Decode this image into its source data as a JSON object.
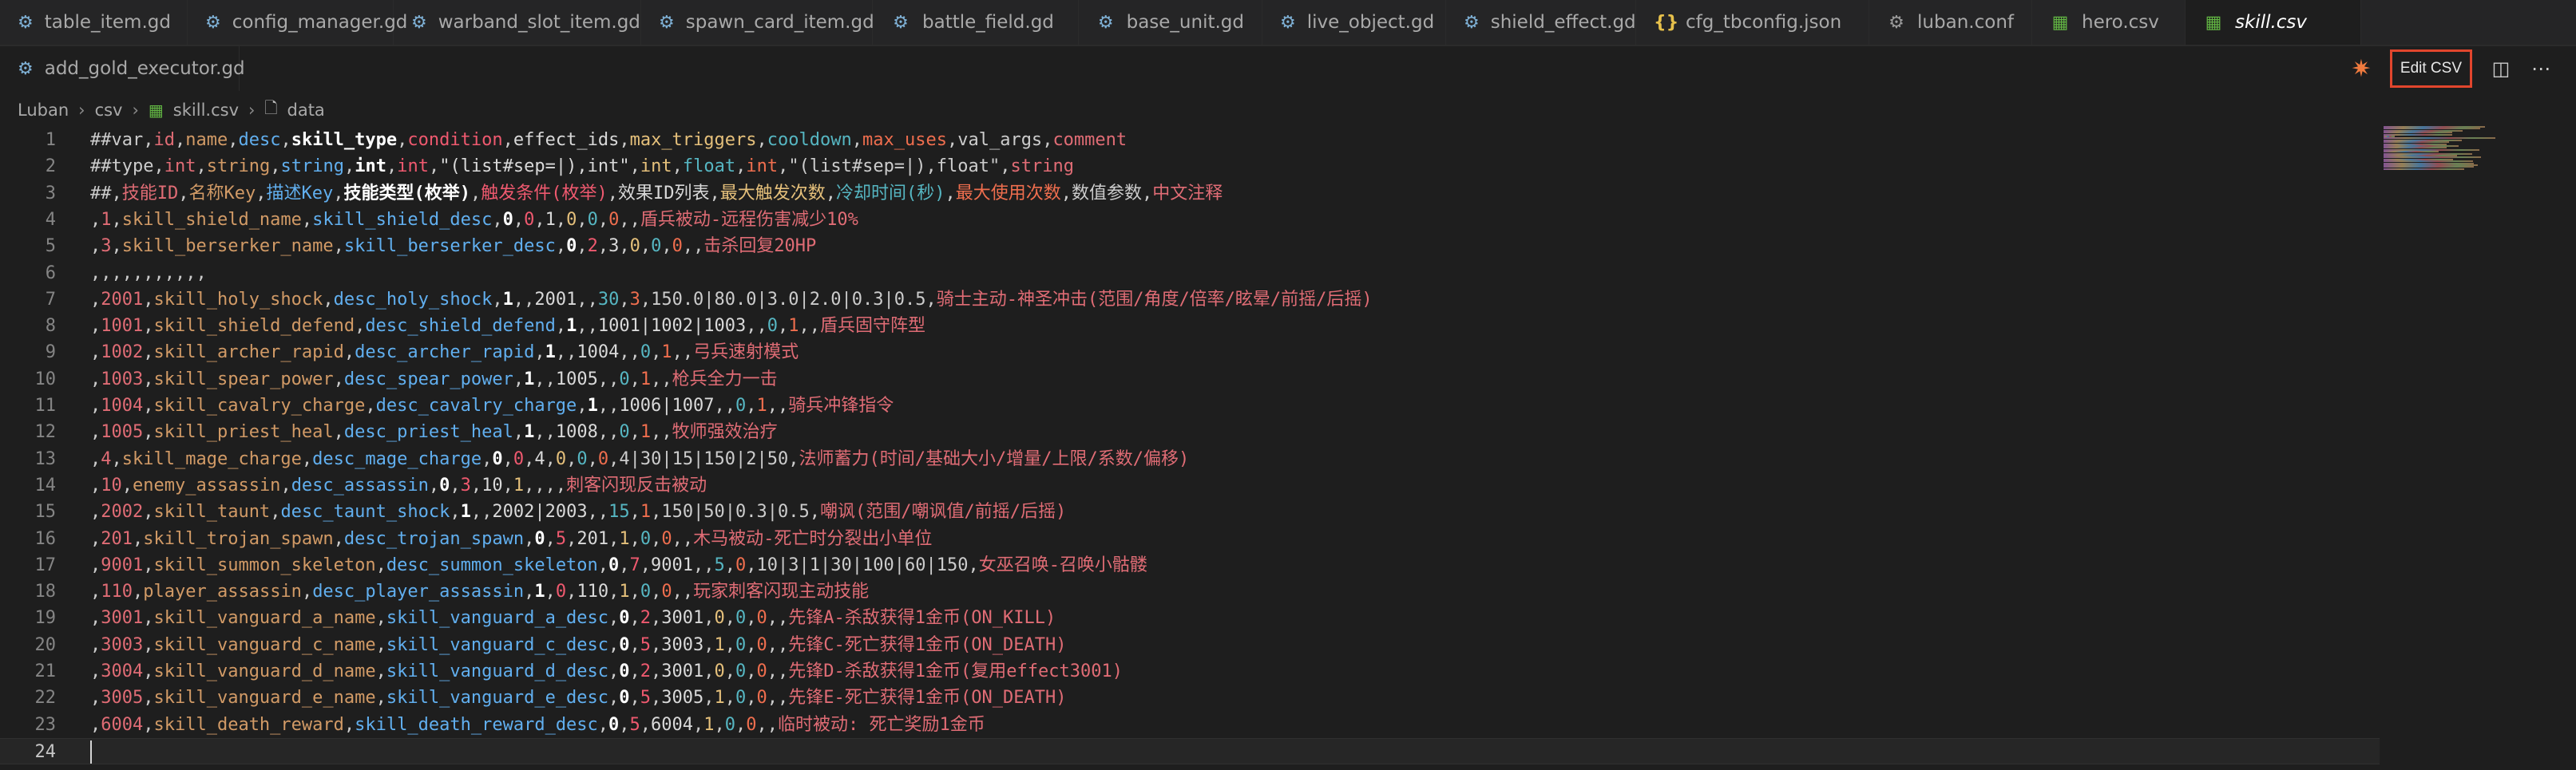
{
  "tabs_row1": [
    {
      "label": "table_item.gd",
      "icon": "gear-icon",
      "active": false
    },
    {
      "label": "config_manager.gd",
      "icon": "gear-icon",
      "active": false
    },
    {
      "label": "warband_slot_item.gd",
      "icon": "gear-icon",
      "active": false
    },
    {
      "label": "spawn_card_item.gd",
      "icon": "gear-icon",
      "active": false
    },
    {
      "label": "battle_field.gd",
      "icon": "gear-icon",
      "active": false
    },
    {
      "label": "base_unit.gd",
      "icon": "gear-icon",
      "active": false
    },
    {
      "label": "live_object.gd",
      "icon": "gear-icon",
      "active": false
    },
    {
      "label": "shield_effect.gd",
      "icon": "gear-icon",
      "active": false
    },
    {
      "label": "cfg_tbconfig.json",
      "icon": "braces-icon",
      "active": false
    },
    {
      "label": "luban.conf",
      "icon": "settings-icon",
      "active": false
    },
    {
      "label": "hero.csv",
      "icon": "table-icon",
      "active": false
    },
    {
      "label": "skill.csv",
      "icon": "table-icon",
      "active": true
    }
  ],
  "tabs_row2": [
    {
      "label": "add_gold_executor.gd",
      "icon": "gear-icon",
      "active": false
    }
  ],
  "toolbar": {
    "edit_csv_label": "Edit CSV"
  },
  "breadcrumb": [
    "Luban",
    "csv",
    "skill.csv",
    "data"
  ],
  "colors": {
    "background": "#1e1e1e",
    "accent_red_border": "#e2462d",
    "csv_icon": "#62b543",
    "gd_icon": "#7fb1d6",
    "json_icon": "#e6c04b"
  },
  "lines": [
    {
      "n": "1",
      "fields": [
        "##var",
        "id",
        "name",
        "desc",
        "skill_type",
        "condition",
        "effect_ids",
        "max_triggers",
        "cooldown",
        "max_uses",
        "val_args",
        "comment"
      ]
    },
    {
      "n": "2",
      "fields": [
        "##type",
        "int",
        "string",
        "string",
        "int",
        "int",
        "\"(list#sep=|),int\"",
        "int",
        "float",
        "int",
        "\"(list#sep=|),float\"",
        "string"
      ]
    },
    {
      "n": "3",
      "fields": [
        "##",
        "技能ID",
        "名称Key",
        "描述Key",
        "技能类型(枚举)",
        "触发条件(枚举)",
        "效果ID列表",
        "最大触发次数",
        "冷却时间(秒)",
        "最大使用次数",
        "数值参数",
        "中文注释"
      ]
    },
    {
      "n": "4",
      "fields": [
        "",
        "1",
        "skill_shield_name",
        "skill_shield_desc",
        "0",
        "0",
        "1",
        "0",
        "0",
        "0",
        "",
        "盾兵被动-远程伤害减少10%"
      ]
    },
    {
      "n": "5",
      "fields": [
        "",
        "3",
        "skill_berserker_name",
        "skill_berserker_desc",
        "0",
        "2",
        "3",
        "0",
        "0",
        "0",
        "",
        "击杀回复20HP"
      ]
    },
    {
      "n": "6",
      "fields": [
        "",
        "",
        "",
        "",
        "",
        "",
        "",
        "",
        "",
        "",
        "",
        ""
      ]
    },
    {
      "n": "7",
      "fields": [
        "",
        "2001",
        "skill_holy_shock",
        "desc_holy_shock",
        "1",
        "",
        "2001",
        "",
        "30",
        "3",
        "150.0|80.0|3.0|2.0|0.3|0.5",
        "骑士主动-神圣冲击(范围/角度/倍率/眩晕/前摇/后摇)"
      ]
    },
    {
      "n": "8",
      "fields": [
        "",
        "1001",
        "skill_shield_defend",
        "desc_shield_defend",
        "1",
        "",
        "1001|1002|1003",
        "",
        "0",
        "1",
        "",
        "盾兵固守阵型"
      ]
    },
    {
      "n": "9",
      "fields": [
        "",
        "1002",
        "skill_archer_rapid",
        "desc_archer_rapid",
        "1",
        "",
        "1004",
        "",
        "0",
        "1",
        "",
        "弓兵速射模式"
      ]
    },
    {
      "n": "10",
      "fields": [
        "",
        "1003",
        "skill_spear_power",
        "desc_spear_power",
        "1",
        "",
        "1005",
        "",
        "0",
        "1",
        "",
        "枪兵全力一击"
      ]
    },
    {
      "n": "11",
      "fields": [
        "",
        "1004",
        "skill_cavalry_charge",
        "desc_cavalry_charge",
        "1",
        "",
        "1006|1007",
        "",
        "0",
        "1",
        "",
        "骑兵冲锋指令"
      ]
    },
    {
      "n": "12",
      "fields": [
        "",
        "1005",
        "skill_priest_heal",
        "desc_priest_heal",
        "1",
        "",
        "1008",
        "",
        "0",
        "1",
        "",
        "牧师强效治疗"
      ]
    },
    {
      "n": "13",
      "fields": [
        "",
        "4",
        "skill_mage_charge",
        "desc_mage_charge",
        "0",
        "0",
        "4",
        "0",
        "0",
        "0",
        "4|30|15|150|2|50",
        "法师蓄力(时间/基础大小/增量/上限/系数/偏移)"
      ]
    },
    {
      "n": "14",
      "fields": [
        "",
        "10",
        "enemy_assassin",
        "desc_assassin",
        "0",
        "3",
        "10",
        "1",
        "",
        "",
        "",
        "刺客闪现反击被动"
      ]
    },
    {
      "n": "15",
      "fields": [
        "",
        "2002",
        "skill_taunt",
        "desc_taunt_shock",
        "1",
        "",
        "2002|2003",
        "",
        "15",
        "1",
        "150|50|0.3|0.5",
        "嘲讽(范围/嘲讽值/前摇/后摇)"
      ]
    },
    {
      "n": "16",
      "fields": [
        "",
        "201",
        "skill_trojan_spawn",
        "desc_trojan_spawn",
        "0",
        "5",
        "201",
        "1",
        "0",
        "0",
        "",
        "木马被动-死亡时分裂出小单位"
      ]
    },
    {
      "n": "17",
      "fields": [
        "",
        "9001",
        "skill_summon_skeleton",
        "desc_summon_skeleton",
        "0",
        "7",
        "9001",
        "",
        "5",
        "0",
        "10|3|1|30|100|60|150",
        "女巫召唤-召唤小骷髅"
      ]
    },
    {
      "n": "18",
      "fields": [
        "",
        "110",
        "player_assassin",
        "desc_player_assassin",
        "1",
        "0",
        "110",
        "1",
        "0",
        "0",
        "",
        "玩家刺客闪现主动技能"
      ]
    },
    {
      "n": "19",
      "fields": [
        "",
        "3001",
        "skill_vanguard_a_name",
        "skill_vanguard_a_desc",
        "0",
        "2",
        "3001",
        "0",
        "0",
        "0",
        "",
        "先锋A-杀敌获得1金币(ON_KILL)"
      ]
    },
    {
      "n": "20",
      "fields": [
        "",
        "3003",
        "skill_vanguard_c_name",
        "skill_vanguard_c_desc",
        "0",
        "5",
        "3003",
        "1",
        "0",
        "0",
        "",
        "先锋C-死亡获得1金币(ON_DEATH)"
      ]
    },
    {
      "n": "21",
      "fields": [
        "",
        "3004",
        "skill_vanguard_d_name",
        "skill_vanguard_d_desc",
        "0",
        "2",
        "3001",
        "0",
        "0",
        "0",
        "",
        "先锋D-杀敌获得1金币(复用effect3001)"
      ]
    },
    {
      "n": "22",
      "fields": [
        "",
        "3005",
        "skill_vanguard_e_name",
        "skill_vanguard_e_desc",
        "0",
        "5",
        "3005",
        "1",
        "0",
        "0",
        "",
        "先锋E-死亡获得1金币(ON_DEATH)"
      ]
    },
    {
      "n": "23",
      "fields": [
        "",
        "6004",
        "skill_death_reward",
        "skill_death_reward_desc",
        "0",
        "5",
        "6004",
        "1",
        "0",
        "0",
        "",
        "临时被动: 死亡奖励1金币"
      ]
    },
    {
      "n": "24",
      "fields": []
    }
  ]
}
